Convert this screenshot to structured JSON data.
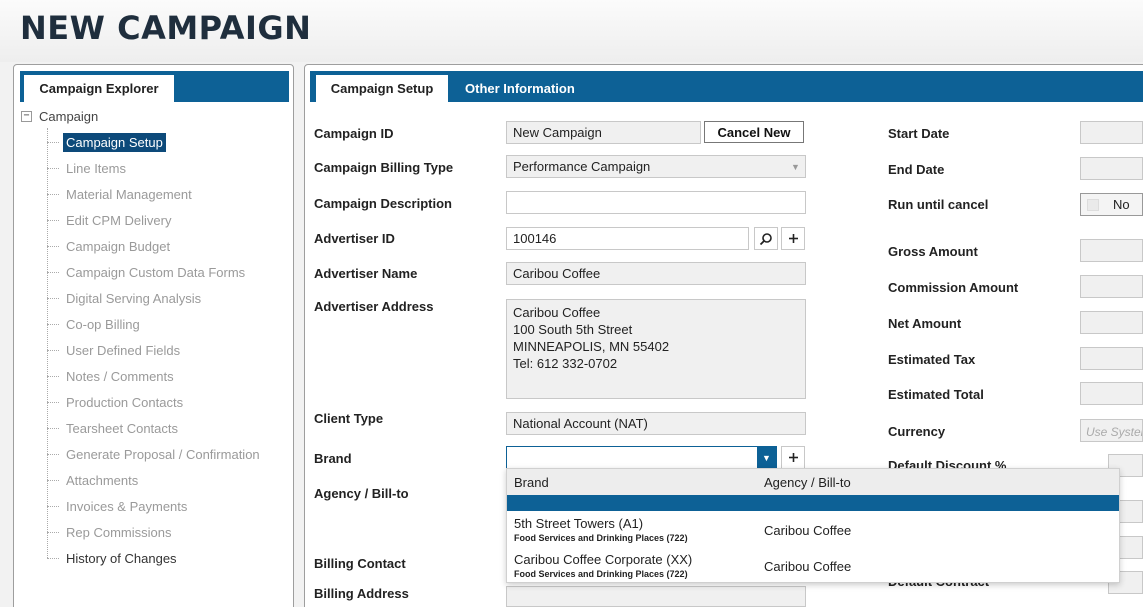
{
  "page_title": "NEW CAMPAIGN",
  "explorer": {
    "tab_label": "Campaign Explorer",
    "root_label": "Campaign",
    "toggle_symbol": "−",
    "items": [
      {
        "label": "Campaign Setup",
        "state": "selected"
      },
      {
        "label": "Line Items",
        "state": "disabled"
      },
      {
        "label": "Material Management",
        "state": "disabled"
      },
      {
        "label": "Edit CPM Delivery",
        "state": "disabled"
      },
      {
        "label": "Campaign Budget",
        "state": "disabled"
      },
      {
        "label": "Campaign Custom Data Forms",
        "state": "disabled"
      },
      {
        "label": "Digital Serving Analysis",
        "state": "disabled"
      },
      {
        "label": "Co-op Billing",
        "state": "disabled"
      },
      {
        "label": "User Defined Fields",
        "state": "disabled"
      },
      {
        "label": "Notes / Comments",
        "state": "disabled"
      },
      {
        "label": "Production Contacts",
        "state": "disabled"
      },
      {
        "label": "Tearsheet Contacts",
        "state": "disabled"
      },
      {
        "label": "Generate Proposal / Confirmation",
        "state": "disabled"
      },
      {
        "label": "Attachments",
        "state": "disabled"
      },
      {
        "label": "Invoices & Payments",
        "state": "disabled"
      },
      {
        "label": "Rep Commissions",
        "state": "disabled"
      },
      {
        "label": "History of Changes",
        "state": "active"
      }
    ]
  },
  "tabs": {
    "active": "Campaign Setup",
    "other": "Other Information"
  },
  "form": {
    "campaign_id_label": "Campaign ID",
    "campaign_id_value": "New Campaign",
    "cancel_new_label": "Cancel New",
    "billing_type_label": "Campaign Billing Type",
    "billing_type_value": "Performance Campaign",
    "description_label": "Campaign Description",
    "description_value": "",
    "advertiser_id_label": "Advertiser ID",
    "advertiser_id_value": "100146",
    "advertiser_name_label": "Advertiser Name",
    "advertiser_name_value": "Caribou Coffee",
    "advertiser_address_label": "Advertiser Address",
    "advertiser_address_lines": [
      "Caribou Coffee",
      "100 South 5th Street",
      "MINNEAPOLIS, MN 55402",
      "Tel: 612 332-0702"
    ],
    "client_type_label": "Client Type",
    "client_type_value": "National Account (NAT)",
    "brand_label": "Brand",
    "brand_value": "",
    "agency_label": "Agency / Bill-to",
    "billing_contact_label": "Billing Contact",
    "billing_address_label": "Billing Address"
  },
  "right": {
    "start_date_label": "Start Date",
    "end_date_label": "End Date",
    "run_until_cancel_label": "Run until cancel",
    "run_until_cancel_value": "No",
    "gross_amount_label": "Gross Amount",
    "commission_amount_label": "Commission Amount",
    "net_amount_label": "Net Amount",
    "estimated_tax_label": "Estimated Tax",
    "estimated_total_label": "Estimated Total",
    "currency_label": "Currency",
    "currency_placeholder": "Use System",
    "default_discount_label": "Default Discount %",
    "default_contract_label": "Default Contract"
  },
  "brand_dropdown": {
    "col_brand": "Brand",
    "col_agency": "Agency / Bill-to",
    "rows": [
      {
        "brand": "5th Street Towers (A1)",
        "category": "Food Services and Drinking Places (722)",
        "agency": "Caribou Coffee"
      },
      {
        "brand": "Caribou Coffee Corporate (XX)",
        "category": "Food Services and Drinking Places (722)",
        "agency": "Caribou Coffee"
      }
    ]
  },
  "icons": {
    "search": "magnifier-icon",
    "add": "plus-icon",
    "dropdown": "chevron-down-icon"
  },
  "colors": {
    "accent": "#0d6196",
    "selected": "#0d4a7a",
    "title": "#1f2e3d"
  }
}
